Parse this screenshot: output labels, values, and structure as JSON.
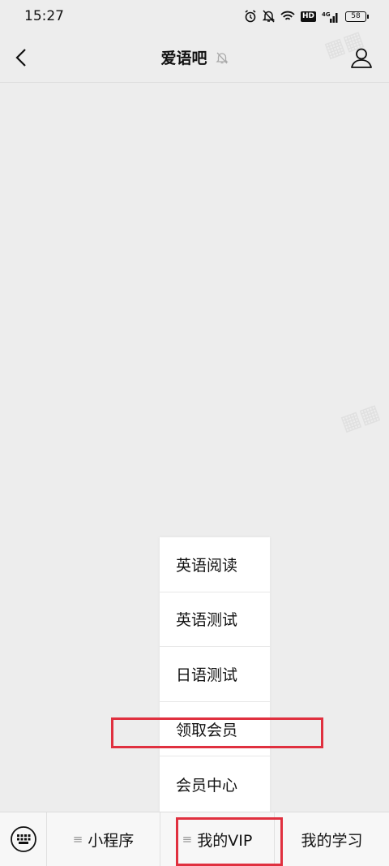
{
  "status_bar": {
    "time": "15:27",
    "network_badge": "HD",
    "network_type": "4G",
    "battery": "58",
    "icons": [
      "alarm-icon",
      "mute-icon",
      "wifi-icon",
      "hd-icon",
      "signal-icon",
      "battery-icon"
    ]
  },
  "header": {
    "title": "爱语吧",
    "icons": [
      "back-icon",
      "muted-bell-icon",
      "profile-icon"
    ]
  },
  "popup_menu": {
    "items": [
      {
        "label": "英语阅读"
      },
      {
        "label": "英语测试"
      },
      {
        "label": "日语测试"
      },
      {
        "label": "领取会员"
      },
      {
        "label": "会员中心"
      }
    ]
  },
  "bottom_menu": {
    "tabs": [
      {
        "label": "小程序",
        "has_submenu": true
      },
      {
        "label": "我的VIP",
        "has_submenu": true
      },
      {
        "label": "我的学习",
        "has_submenu": false
      }
    ],
    "menu_glyph": "≡"
  },
  "colors": {
    "background": "#ededed",
    "highlight": "#e0303f",
    "menu_bg": "#ffffff"
  }
}
